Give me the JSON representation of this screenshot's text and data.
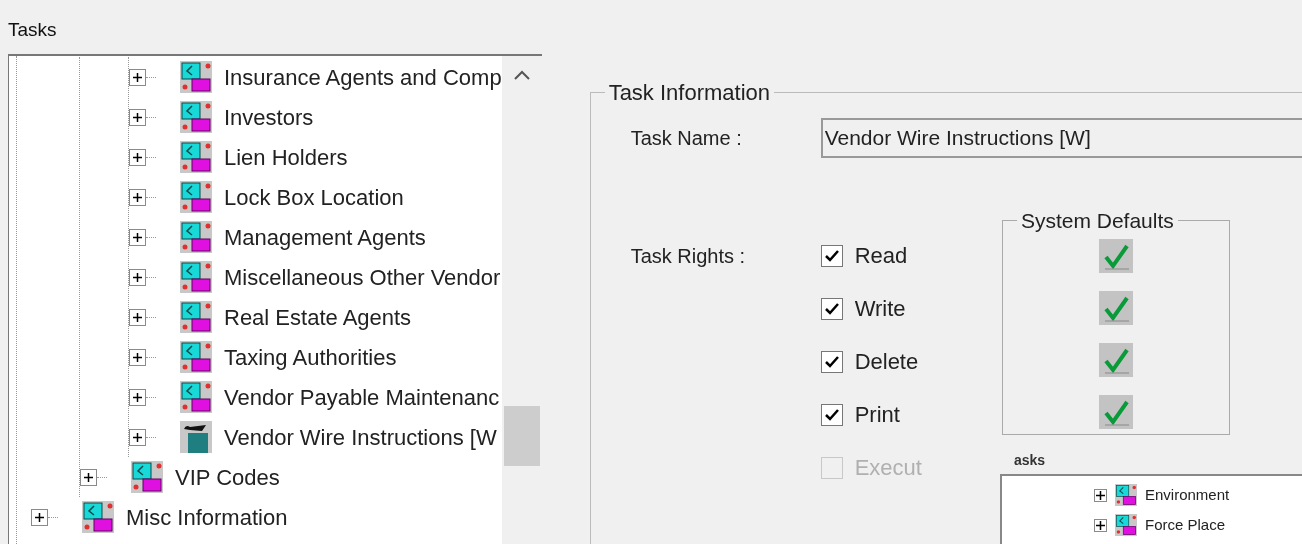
{
  "panel_title": "Tasks",
  "tree": {
    "items": [
      {
        "expanded": true,
        "children": [
          {
            "expanded": true,
            "children": [
              {
                "label": "Insurance Agents and Comp",
                "kind": "group",
                "expanded": false
              },
              {
                "label": "Investors",
                "kind": "group",
                "expanded": false
              },
              {
                "label": "Lien Holders",
                "kind": "group",
                "expanded": false
              },
              {
                "label": "Lock Box Location",
                "kind": "group",
                "expanded": false
              },
              {
                "label": "Management Agents",
                "kind": "group",
                "expanded": false
              },
              {
                "label": "Miscellaneous Other Vendor",
                "kind": "group",
                "expanded": false
              },
              {
                "label": "Real Estate Agents",
                "kind": "group",
                "expanded": false
              },
              {
                "label": "Taxing Authorities",
                "kind": "group",
                "expanded": false
              },
              {
                "label": "Vendor Payable Maintenanc",
                "kind": "group",
                "expanded": false
              },
              {
                "label": "Vendor Wire Instructions [W",
                "kind": "wire",
                "expanded": false
              }
            ]
          },
          {
            "label": "VIP Codes",
            "kind": "group",
            "expanded": false
          }
        ]
      },
      {
        "label": "Misc Information",
        "kind": "group",
        "expanded": false
      }
    ]
  },
  "task_info": {
    "title": "Task Information",
    "name_label": "Task Name :",
    "name_value": "Vendor Wire Instructions [W]",
    "rights_label": "Task Rights :",
    "defaults_title": "System Defaults",
    "rights": [
      {
        "label": "Read",
        "checked": true,
        "disabled": false,
        "system_default": true
      },
      {
        "label": "Write",
        "checked": true,
        "disabled": false,
        "system_default": true
      },
      {
        "label": "Delete",
        "checked": true,
        "disabled": false,
        "system_default": true
      },
      {
        "label": "Print",
        "checked": true,
        "disabled": false,
        "system_default": true
      },
      {
        "label": "Execut",
        "checked": false,
        "disabled": true,
        "system_default": false
      }
    ]
  },
  "inset": {
    "title": "asks",
    "items": [
      {
        "label": "Environment",
        "expanded": false
      },
      {
        "label": "Force Place",
        "expanded": false
      }
    ]
  }
}
